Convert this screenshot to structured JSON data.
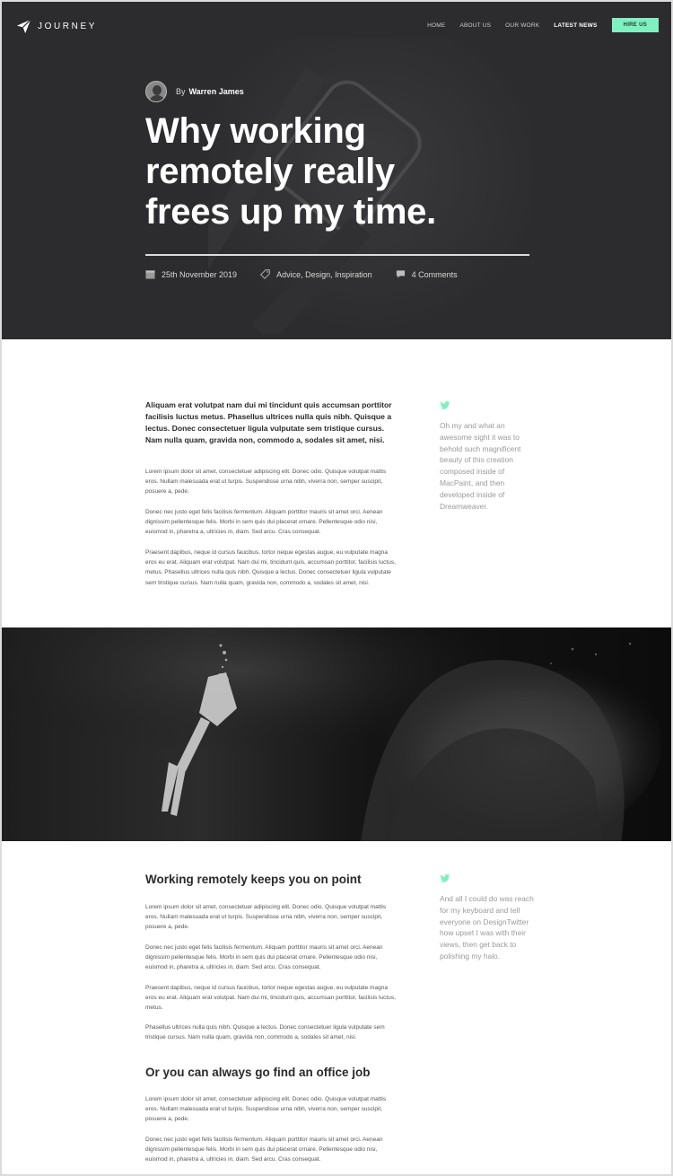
{
  "brand": {
    "name": "JOURNEY"
  },
  "nav": {
    "items": [
      {
        "label": "HOME"
      },
      {
        "label": "ABOUT US"
      },
      {
        "label": "OUR WORK"
      },
      {
        "label": "LATEST NEWS"
      }
    ],
    "cta": "HIRE US"
  },
  "post": {
    "author_prefix": "By",
    "author_name": "Warren James",
    "title": "Why working remotely really frees up my time.",
    "date": "25th November 2019",
    "categories": "Advice, Design, Inspiration",
    "comments": "4 Comments"
  },
  "intro": {
    "lead": "Aliquam erat volutpat nam dui mi tincidunt quis accumsan porttitor facilisis luctus metus. Phasellus ultrices nulla quis nibh. Quisque a lectus. Donec consectetuer ligula vulputate sem tristique cursus. Nam nulla quam, gravida non, commodo a, sodales sit amet, nisi.",
    "paragraphs": [
      "Lorem ipsum dolor sit amet, consectetuer adipiscing elit. Donec odio. Quisque volutpat mattis eros. Nullam malesuada erat ut turpis. Suspendisse urna nibh, viverra non, semper suscipit, posuere a, pede.",
      "Donec nec justo eget felis facilisis fermentum. Aliquam porttitor mauris sit amet orci. Aenean dignissim pellentesque felis. Morbi in sem quis dui placerat ornare. Pellentesque odio nisi, euismod in, pharetra a, ultricies in, diam. Sed arcu. Cras consequat.",
      "Praesent dapibus, neque id cursus faucibus, tortor neque egestas augue, eu vulputate magna eros eu erat. Aliquam erat volutpat. Nam dui mi, tincidunt quis, accumsan porttitor, facilisis luctus, metus. Phasellus ultrices nulla quis nibh. Quisque a lectus. Donec consectetuer ligula vulputate sem tristique cursus. Nam nulla quam, gravida non, commodo a, sodales sit amet, nisi."
    ],
    "tweet": "Oh my and what an awesome sight it was to behold such magnificent beauty of this creation composed inside of MacPaint, and then developed inside of Dreamweaver."
  },
  "section1": {
    "heading": "Working remotely keeps you on point",
    "paragraphs": [
      "Lorem ipsum dolor sit amet, consectetuer adipiscing elit. Donec odio. Quisque volutpat mattis eros. Nullam malesuada erat ut turpis. Suspendisse urna nibh, viverra non, semper suscipit, posuere a, pede.",
      "Donec nec justo eget felis facilisis fermentum. Aliquam porttitor mauris sit amet orci. Aenean dignissim pellentesque felis. Morbi in sem quis dui placerat ornare. Pellentesque odio nisi, euismod in, pharetra a, ultricies in, diam. Sed arcu. Cras consequat.",
      "Praesent dapibus, neque id cursus faucibus, tortor neque egestas augue, eu vulputate magna eros eu erat. Aliquam erat volutpat. Nam dui mi, tincidunt quis, accumsan porttitor, facilisis luctus, metus.",
      "Phasellus ultrices nulla quis nibh. Quisque a lectus. Donec consectetuer ligula vulputate sem tristique cursus. Nam nulla quam, gravida non, commodo a, sodales sit amet, nisi."
    ],
    "tweet": "And all I could do was reach for my keyboard and tell everyone on DesignTwitter how upset I was with their views, then get back to polishing my halo."
  },
  "section2": {
    "heading": "Or you can always go find an office job",
    "paragraphs": [
      "Lorem ipsum dolor sit amet, consectetuer adipiscing elit. Donec odio. Quisque volutpat mattis eros. Nullam malesuada erat ut turpis. Suspendisse urna nibh, viverra non, semper suscipit, posuere a, pede.",
      "Donec nec justo eget felis facilisis fermentum. Aliquam porttitor mauris sit amet orci. Aenean dignissim pellentesque felis. Morbi in sem quis dui placerat ornare. Pellentesque odio nisi, euismod in, pharetra a, ultricies in, diam. Sed arcu. Cras consequat."
    ]
  },
  "icons": {
    "logo": "paper-plane-icon",
    "date": "calendar-icon",
    "categories": "tag-icon",
    "comments": "speech-bubble-icon",
    "tweet": "twitter-bird-icon"
  },
  "colors": {
    "hero_bg": "#2c2c2e",
    "accent": "#7ff0bf",
    "text_dark": "#2a2a2a",
    "text_muted": "#9a9a9a"
  }
}
